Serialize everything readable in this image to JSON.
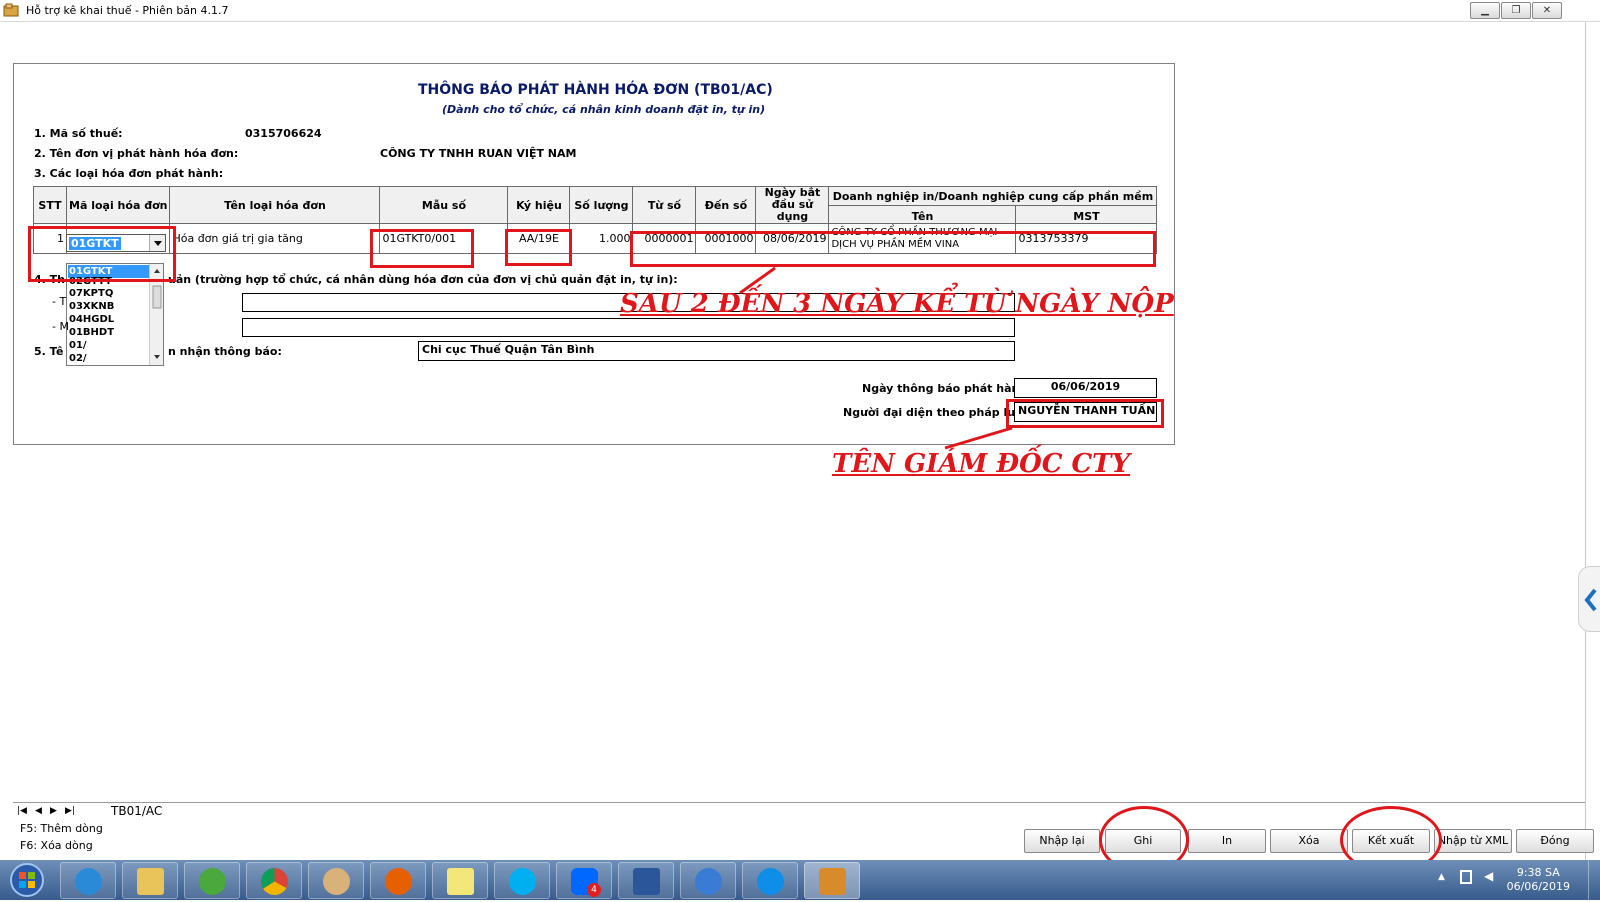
{
  "window": {
    "title": "Hỗ trợ kê khai thuế -  Phiên bản 4.1.7",
    "min_icon": "minimize-icon",
    "restore_icon": "restore-icon",
    "close_icon": "close-icon"
  },
  "form": {
    "title": "THÔNG BÁO PHÁT HÀNH HÓA ĐƠN (TB01/AC)",
    "subtitle": "(Dành cho tổ chức, cá nhân kinh doanh đặt in, tự in)",
    "tax_code_label": "1. Mã số thuế:",
    "tax_code": "0315706624",
    "issuer_label": "2. Tên đơn vị phát hành hóa đơn:",
    "issuer": "CÔNG TY TNHH RUAN VIỆT NAM",
    "invoice_types_label": "3. Các loại hóa đơn phát hành:",
    "section4_label_a": "4. Th",
    "section4_label_b": "uản (trường hợp tổ chức, cá nhân dùng hóa đơn của đơn vị chủ quản đặt in, tự in):",
    "section4_line1_prefix": "- T",
    "section4_line2_prefix": "- M",
    "section5_label_a": "5. Tê",
    "section5_label_b": "n nhận thông báo:",
    "receiving_agency": "Chi cục Thuế Quận Tân Bình",
    "issue_date_label": "Ngày thông báo phát hành:",
    "issue_date": "06/06/2019",
    "representative_label": "Người đại diện theo pháp luật:",
    "representative": "NGUYỄN THANH TUẤN"
  },
  "table": {
    "headers": {
      "stt": "STT",
      "code": "Mã loại hóa đơn",
      "name": "Tên loại hóa đơn",
      "form": "Mẫu số",
      "symbol": "Ký hiệu",
      "qty": "Số lượng",
      "from": "Từ số",
      "to": "Đến số",
      "start_date": "Ngày bắt đầu sử dụng",
      "provider": "Doanh nghiệp in/Doanh nghiệp cung cấp phần mềm",
      "provider_name": "Tên",
      "provider_tax": "MST"
    },
    "row": {
      "stt": "1",
      "code": "01GTKT",
      "name": "Hóa đơn giá trị gia tăng",
      "form": "01GTKT0/001",
      "symbol": "AA/19E",
      "qty": "1.000",
      "from": "0000001",
      "to": "0001000",
      "start_date": "08/06/2019",
      "provider_name_1": "CÔNG TY CỔ PHẦN THƯƠNG MẠI",
      "provider_name_2": "DỊCH VỤ PHẦN MỀM VINA",
      "provider_tax": "0313753379"
    }
  },
  "dropdown": {
    "options": [
      "01GTKT",
      "02GTTT",
      "07KPTQ",
      "03XKNB",
      "04HGDL",
      "01BHDT",
      "01/",
      "02/"
    ],
    "selected": "01GTKT"
  },
  "annotations": {
    "note1": "SAU 2 ĐẾN 3 NGÀY KỂ TỪ NGÀY NỘP",
    "note2": "TÊN GIÁM ĐỐC CTY"
  },
  "sheet": {
    "tab": "TB01/AC",
    "hint1": "F5: Thêm dòng",
    "hint2": "F6: Xóa dòng"
  },
  "buttons": {
    "reset": "Nhập lại",
    "save": "Ghi",
    "print": "In",
    "delete": "Xóa",
    "export": "Kết xuất",
    "import_xml": "Nhập từ XML",
    "close": "Đóng"
  },
  "taskbar": {
    "time": "9:38 SA",
    "date": "06/06/2019",
    "zalo_badge": "4"
  },
  "colors": {
    "annotation_red": "#e0161b",
    "selection_blue": "#3399ff",
    "taskbar": "#375b8c"
  }
}
